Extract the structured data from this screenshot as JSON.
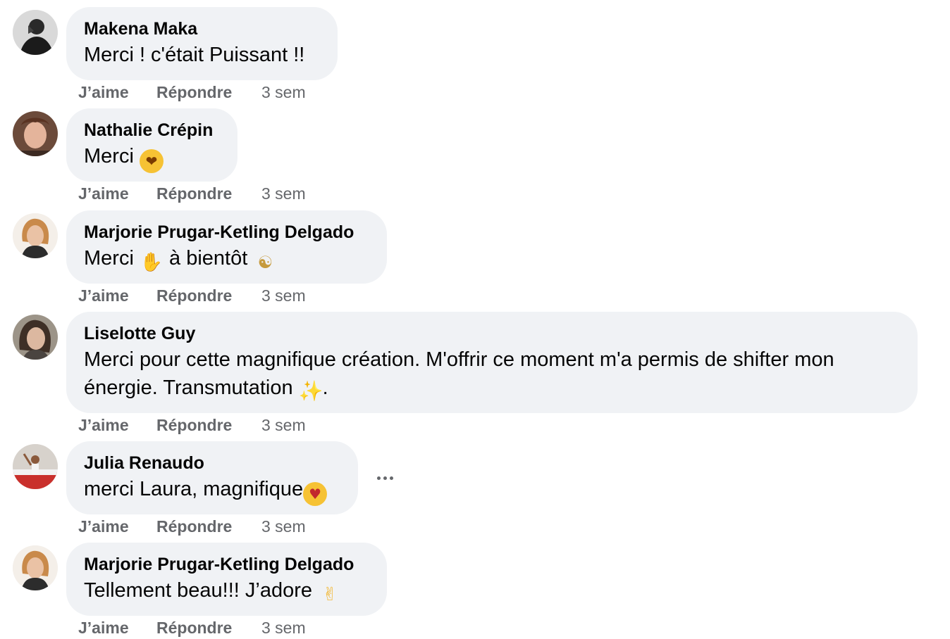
{
  "comments": [
    {
      "author": "Makena Maka",
      "text": "Merci ! c'était Puissant !!",
      "avatar_icon": "avatar-makena-maka",
      "actions": {
        "like": "J’aime",
        "reply": "Répondre",
        "time": "3 sem"
      }
    },
    {
      "author": "Nathalie Crépin",
      "text_before": "Merci ",
      "emoji": "kissing-heart-emoji",
      "avatar_icon": "avatar-nathalie-crepin",
      "actions": {
        "like": "J’aime",
        "reply": "Répondre",
        "time": "3 sem"
      }
    },
    {
      "author": "Marjorie Prugar-Ketling Delgado",
      "text_a": "Merci ",
      "text_b": " à bientôt ",
      "emoji_a": "waving-hand-emoji",
      "emoji_b": "person-in-lotus-position-emoji",
      "avatar_icon": "avatar-marjorie-prugar-ketling-delgado",
      "actions": {
        "like": "J’aime",
        "reply": "Répondre",
        "time": "3 sem"
      }
    },
    {
      "author": "Liselotte Guy",
      "text_line1": "Merci pour cette magnifique création. M'offrir ce moment m'a permis de shifter mon",
      "text_line2": "énergie. Transmutation ",
      "text_end": ".",
      "emoji": "sparkles-emoji",
      "avatar_icon": "avatar-liselotte-guy",
      "actions": {
        "like": "J’aime",
        "reply": "Répondre",
        "time": "3 sem"
      }
    },
    {
      "author": "Julia Renaudo",
      "text": "merci Laura, magnifique",
      "emoji": "smiling-face-with-hearts-emoji",
      "avatar_icon": "avatar-julia-renaudo",
      "actions": {
        "like": "J’aime",
        "reply": "Répondre",
        "time": "3 sem"
      }
    },
    {
      "author": "Marjorie Prugar-Ketling Delgado",
      "text": "Tellement beau!!! J’adore ",
      "emoji": "call-me-hand-emoji",
      "avatar_icon": "avatar-marjorie-prugar-ketling-delgado",
      "actions": {
        "like": "J’aime",
        "reply": "Répondre",
        "time": "3 sem"
      }
    }
  ],
  "more_options_icon": "more-horizontal-icon",
  "colors": {
    "bubble_background": "#f0f2f5",
    "text_primary": "#050505",
    "text_secondary": "#65676b"
  }
}
